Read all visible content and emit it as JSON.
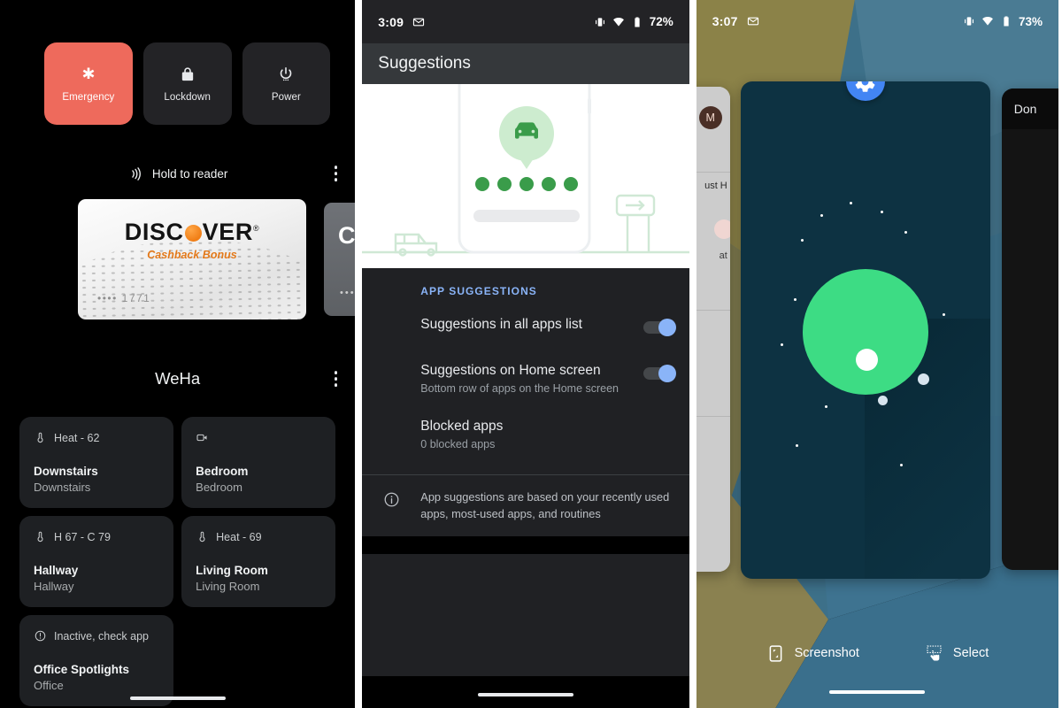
{
  "panel1": {
    "name": "android-power-menu-wallet-home-controls",
    "power_buttons": [
      {
        "label": "Emergency",
        "icon": "emergency-asterisk-icon",
        "color": "#ee6a5c"
      },
      {
        "label": "Lockdown",
        "icon": "lock-icon",
        "color": "#232326"
      },
      {
        "label": "Power",
        "icon": "power-icon",
        "color": "#232326"
      }
    ],
    "wallet": {
      "nfc_icon": "contactless-icon",
      "nfc_text": "Hold to reader",
      "overflow_icon": "more-vertical-icon",
      "cards": [
        {
          "brand": "DISC",
          "brand_rest": "VER",
          "tagline": "Cashback Bonus",
          "digits": "•••• 1771"
        },
        {
          "brand": "CI",
          "digits": "••••"
        }
      ]
    },
    "home": {
      "title": "WeHa",
      "overflow_icon": "more-vertical-icon",
      "tiles": [
        {
          "status": "Heat - 62",
          "icon": "thermostat-icon",
          "name": "Downstairs",
          "room": "Downstairs"
        },
        {
          "status": "",
          "icon": "camera-icon",
          "name": "Bedroom",
          "room": "Bedroom"
        },
        {
          "status": "H 67 - C 79",
          "icon": "thermostat-icon",
          "name": "Hallway",
          "room": "Hallway"
        },
        {
          "status": "Heat - 69",
          "icon": "thermostat-icon",
          "name": "Living Room",
          "room": "Living Room"
        },
        {
          "status": "Inactive, check app",
          "icon": "error-outline-icon",
          "name": "Office Spotlights",
          "room": "Office"
        }
      ]
    }
  },
  "panel2": {
    "name": "android-suggestions-settings",
    "statusbar": {
      "time": "3:09",
      "mail_icon": "envelope-icon",
      "vibrate_icon": "vibrate-icon",
      "wifi_icon": "wifi-icon",
      "battery_icon": "battery-icon",
      "battery": "72%"
    },
    "appbar": {
      "title": "Suggestions"
    },
    "illustration": {
      "name": "driving-suggestion-illustration",
      "phone_icon": "phone-outline",
      "bubble_icon": "car-icon",
      "dot_count": 5,
      "sign_icon": "arrow-sign-icon",
      "car_icon": "car-side-icon"
    },
    "section_header": "APP SUGGESTIONS",
    "rows": [
      {
        "title": "Suggestions in all apps list",
        "subtitle": "",
        "control": "toggle",
        "value": "on"
      },
      {
        "title": "Suggestions on Home screen",
        "subtitle": "Bottom row of apps on the Home screen",
        "control": "toggle",
        "value": "on"
      },
      {
        "title": "Blocked apps",
        "subtitle": "0 blocked apps",
        "control": "none",
        "value": ""
      }
    ],
    "footnote": {
      "icon": "info-icon",
      "text": "App suggestions are based on your recently used apps, most-used apps, and routines"
    }
  },
  "panel3": {
    "name": "android-recents-overview",
    "statusbar": {
      "time": "3:07",
      "mail_icon": "envelope-icon",
      "vibrate_icon": "vibrate-icon",
      "wifi_icon": "wifi-icon",
      "battery_icon": "battery-icon",
      "battery": "73%"
    },
    "cards": [
      {
        "position": "left",
        "app": "partial-light-card",
        "avatar": "M",
        "fragment_1": "ust H",
        "fragment_2": "at"
      },
      {
        "position": "center",
        "app": "Settings",
        "icon": "settings-gear-icon",
        "art": "green-planet-space"
      },
      {
        "position": "right",
        "app": "partial-dark-card",
        "fragment_1": "Don"
      }
    ],
    "actions": [
      {
        "label": "Screenshot",
        "icon": "screenshot-icon"
      },
      {
        "label": "Select",
        "icon": "select-hand-icon"
      }
    ]
  },
  "colors": {
    "emergency_red": "#ee6a5c",
    "accent_blue": "#8ab4f8",
    "gear_blue": "#4285f4",
    "android_green": "#3ddc84",
    "card_space": "#0d3242",
    "surface_dark": "#202124",
    "tile_dark": "#1e2023"
  }
}
